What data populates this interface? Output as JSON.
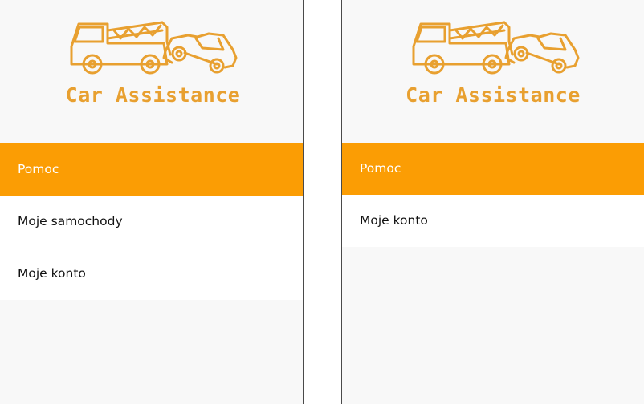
{
  "app": {
    "brand_title": "Car Assistance",
    "accent_color": "#fb9d04",
    "logo_color": "#e8a030",
    "logo_icon": "tow-truck-icon"
  },
  "left_screen": {
    "menu": [
      {
        "label": "Pomoc",
        "active": true
      },
      {
        "label": "Moje samochody",
        "active": false
      },
      {
        "label": "Moje konto",
        "active": false
      }
    ]
  },
  "right_screen": {
    "menu": [
      {
        "label": "Pomoc",
        "active": true
      },
      {
        "label": "Moje konto",
        "active": false
      }
    ]
  }
}
